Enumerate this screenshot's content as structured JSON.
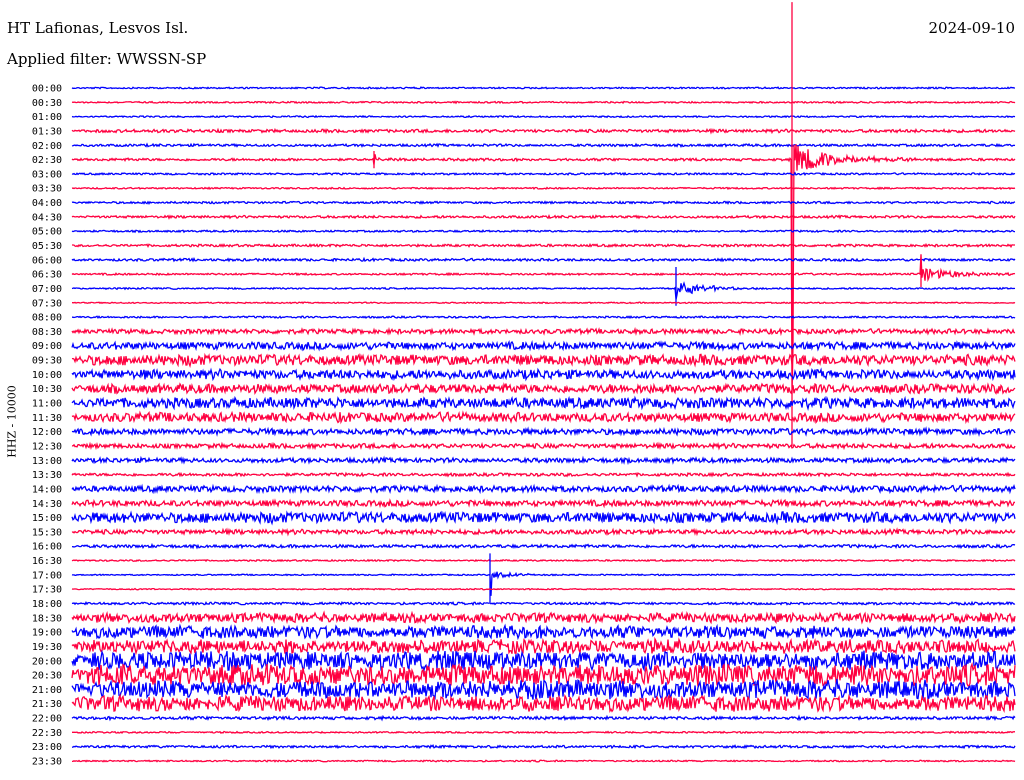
{
  "header": {
    "station": "HT Lafionas, Lesvos Isl.",
    "filter": "Applied filter: WWSSN-SP",
    "date": "2024-09-10"
  },
  "chart_data": {
    "type": "line",
    "title": "HT Lafionas, Lesvos Isl.",
    "subtitle": "Applied filter: WWSSN-SP",
    "ylabel": "HHZ - 10000",
    "x_unit": "minutes",
    "x_range": [
      0,
      30
    ],
    "colors": [
      "#0000ff",
      "#ff0040"
    ],
    "traces": [
      {
        "label": "00:00",
        "noise": 0.05
      },
      {
        "label": "00:30",
        "noise": 0.05
      },
      {
        "label": "01:00",
        "noise": 0.05
      },
      {
        "label": "01:30",
        "noise": 0.1
      },
      {
        "label": "02:00",
        "noise": 0.08
      },
      {
        "label": "02:30",
        "noise": 0.08
      },
      {
        "label": "03:00",
        "noise": 0.06
      },
      {
        "label": "03:30",
        "noise": 0.05
      },
      {
        "label": "04:00",
        "noise": 0.07
      },
      {
        "label": "04:30",
        "noise": 0.08
      },
      {
        "label": "05:00",
        "noise": 0.06
      },
      {
        "label": "05:30",
        "noise": 0.08
      },
      {
        "label": "06:00",
        "noise": 0.08
      },
      {
        "label": "06:30",
        "noise": 0.06
      },
      {
        "label": "07:00",
        "noise": 0.05
      },
      {
        "label": "07:30",
        "noise": 0.04
      },
      {
        "label": "08:00",
        "noise": 0.06
      },
      {
        "label": "08:30",
        "noise": 0.15
      },
      {
        "label": "09:00",
        "noise": 0.25
      },
      {
        "label": "09:30",
        "noise": 0.35
      },
      {
        "label": "10:00",
        "noise": 0.3
      },
      {
        "label": "10:30",
        "noise": 0.3
      },
      {
        "label": "11:00",
        "noise": 0.35
      },
      {
        "label": "11:30",
        "noise": 0.3
      },
      {
        "label": "12:00",
        "noise": 0.2
      },
      {
        "label": "12:30",
        "noise": 0.15
      },
      {
        "label": "13:00",
        "noise": 0.15
      },
      {
        "label": "13:30",
        "noise": 0.1
      },
      {
        "label": "14:00",
        "noise": 0.2
      },
      {
        "label": "14:30",
        "noise": 0.2
      },
      {
        "label": "15:00",
        "noise": 0.35
      },
      {
        "label": "15:30",
        "noise": 0.15
      },
      {
        "label": "16:00",
        "noise": 0.1
      },
      {
        "label": "16:30",
        "noise": 0.05
      },
      {
        "label": "17:00",
        "noise": 0.04
      },
      {
        "label": "17:30",
        "noise": 0.04
      },
      {
        "label": "18:00",
        "noise": 0.08
      },
      {
        "label": "18:30",
        "noise": 0.3
      },
      {
        "label": "19:00",
        "noise": 0.4
      },
      {
        "label": "19:30",
        "noise": 0.45
      },
      {
        "label": "20:00",
        "noise": 0.6
      },
      {
        "label": "20:30",
        "noise": 0.7
      },
      {
        "label": "21:00",
        "noise": 0.6
      },
      {
        "label": "21:30",
        "noise": 0.5
      },
      {
        "label": "22:00",
        "noise": 0.1
      },
      {
        "label": "22:30",
        "noise": 0.05
      },
      {
        "label": "23:00",
        "noise": 0.08
      },
      {
        "label": "23:30",
        "noise": 0.05
      }
    ],
    "events": [
      {
        "trace": "02:30",
        "minute": 22.9,
        "peak_up": 11,
        "peak_down": 20,
        "coda": 1.2,
        "duration": 1.2
      },
      {
        "trace": "02:30",
        "minute": 9.6,
        "peak_up": 0.6,
        "peak_down": 0.6,
        "coda": 0.2,
        "duration": 0.5
      },
      {
        "trace": "06:30",
        "minute": 27.0,
        "peak_up": 0.9,
        "peak_down": 0.9,
        "coda": 0.5,
        "duration": 1.2
      },
      {
        "trace": "07:00",
        "minute": 19.2,
        "peak_up": 1.5,
        "peak_down": 1.2,
        "coda": 0.6,
        "duration": 0.9
      },
      {
        "trace": "17:00",
        "minute": 13.3,
        "peak_up": 1.5,
        "peak_down": 1.9,
        "coda": 0.4,
        "duration": 0.6
      }
    ]
  }
}
